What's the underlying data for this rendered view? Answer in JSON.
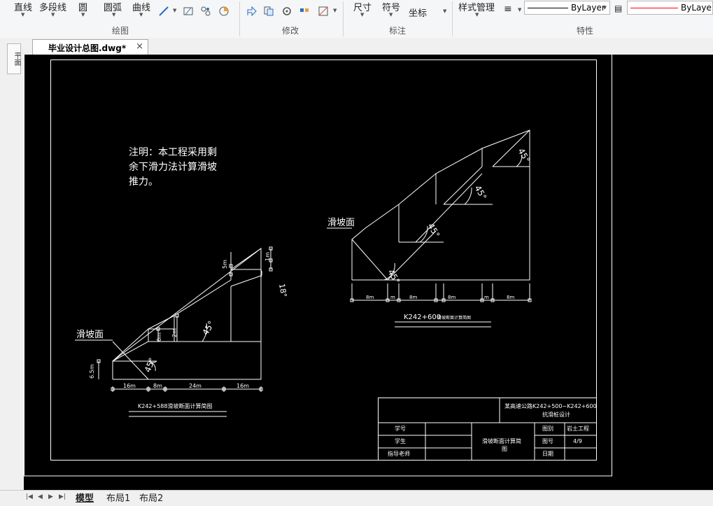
{
  "ribbon": {
    "draw": {
      "line": "直线",
      "polyline": "多段线",
      "circle": "圆",
      "arc": "圆弧",
      "curve": "曲线",
      "title": "绘图"
    },
    "modify": {
      "title": "修改"
    },
    "annotate": {
      "dimension": "尺寸",
      "symbol": "符号",
      "coordinate": "坐标",
      "title": "标注"
    },
    "properties": {
      "style_manager": "样式管理",
      "linetype": "ByLayer",
      "color": "ByLaye",
      "title": "特性",
      "color_hex": "#ff0000"
    }
  },
  "tab": {
    "filename": "毕业设计总图.dwg*",
    "close": "×"
  },
  "leftbar": {
    "label": "平面"
  },
  "drawing": {
    "note": [
      "注明：本工程采用剩",
      "余下滑力法计算滑坡",
      "推力。"
    ],
    "left_section": {
      "slide_label": "滑坡面",
      "angles": [
        "45°",
        "45°",
        "18°"
      ],
      "heights": [
        "6.5m",
        "2m",
        "6m",
        "5m",
        "1m"
      ],
      "dims": [
        "16m",
        "8m",
        "24m",
        "16m"
      ],
      "title": "K242+588滑坡断面计算简图"
    },
    "right_section": {
      "slide_label": "滑坡面",
      "angles": [
        "45°",
        "45°",
        "45°",
        "45°"
      ],
      "dims": [
        "8m",
        "m",
        "8m",
        "8m",
        "m",
        "8m",
        "m",
        "8m"
      ],
      "title_prefix": "K242+600",
      "title_suffix": "滑坡断面计算简图"
    },
    "title_block": {
      "project": [
        "某高速公路K242+500~K242+600",
        "抗滑桩设计"
      ],
      "row_labels": [
        "学号",
        "学生",
        "指导老师"
      ],
      "drawing_name": [
        "滑坡断面计算简",
        "图"
      ],
      "category_label": "图别",
      "category_value": "岩土工程",
      "number_label": "图号",
      "number_value": "4/9",
      "date_label": "日期"
    }
  },
  "bottom": {
    "tabs": [
      "模型",
      "布局1",
      "布局2"
    ]
  }
}
